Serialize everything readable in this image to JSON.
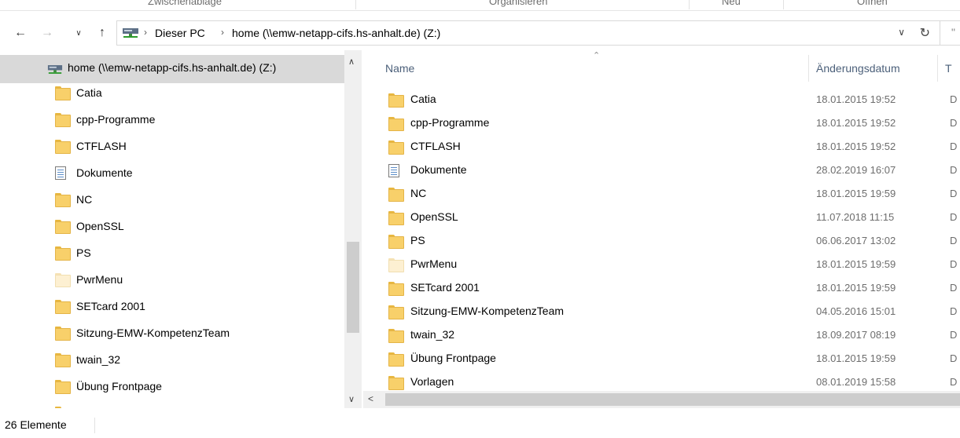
{
  "ribbon": {
    "groups": [
      "Zwischenablage",
      "Organisieren",
      "Neu",
      "Öffnen"
    ]
  },
  "address": {
    "root_label": "Dieser PC",
    "current_label": "home (\\\\emw-netapp-cifs.hs-anhalt.de) (Z:)",
    "search_text": "\""
  },
  "nav": {
    "header_label": "home (\\\\emw-netapp-cifs.hs-anhalt.de) (Z:)",
    "items": [
      {
        "label": "Catia",
        "icon": "folder-icon"
      },
      {
        "label": "cpp-Programme",
        "icon": "folder-icon"
      },
      {
        "label": "CTFLASH",
        "icon": "folder-icon"
      },
      {
        "label": "Dokumente",
        "icon": "document-icon"
      },
      {
        "label": "NC",
        "icon": "folder-icon"
      },
      {
        "label": "OpenSSL",
        "icon": "folder-icon"
      },
      {
        "label": "PS",
        "icon": "folder-icon"
      },
      {
        "label": "PwrMenu",
        "icon": "folder-pale-icon"
      },
      {
        "label": "SETcard 2001",
        "icon": "folder-icon"
      },
      {
        "label": "Sitzung-EMW-KompetenzTeam",
        "icon": "folder-icon"
      },
      {
        "label": "twain_32",
        "icon": "folder-icon"
      },
      {
        "label": "Übung Frontpage",
        "icon": "folder-icon"
      }
    ]
  },
  "columns": {
    "name": "Name",
    "date": "Änderungsdatum",
    "type": "T"
  },
  "files": [
    {
      "name": "Catia",
      "date": "18.01.2015 19:52",
      "type": "D",
      "icon": "folder-icon"
    },
    {
      "name": "cpp-Programme",
      "date": "18.01.2015 19:52",
      "type": "D",
      "icon": "folder-icon"
    },
    {
      "name": "CTFLASH",
      "date": "18.01.2015 19:52",
      "type": "D",
      "icon": "folder-icon"
    },
    {
      "name": "Dokumente",
      "date": "28.02.2019 16:07",
      "type": "D",
      "icon": "document-icon"
    },
    {
      "name": "NC",
      "date": "18.01.2015 19:59",
      "type": "D",
      "icon": "folder-icon"
    },
    {
      "name": "OpenSSL",
      "date": "11.07.2018 11:15",
      "type": "D",
      "icon": "folder-icon"
    },
    {
      "name": "PS",
      "date": "06.06.2017 13:02",
      "type": "D",
      "icon": "folder-icon"
    },
    {
      "name": "PwrMenu",
      "date": "18.01.2015 19:59",
      "type": "D",
      "icon": "folder-pale-icon"
    },
    {
      "name": "SETcard 2001",
      "date": "18.01.2015 19:59",
      "type": "D",
      "icon": "folder-icon"
    },
    {
      "name": "Sitzung-EMW-KompetenzTeam",
      "date": "04.05.2016 15:01",
      "type": "D",
      "icon": "folder-icon"
    },
    {
      "name": "twain_32",
      "date": "18.09.2017 08:19",
      "type": "D",
      "icon": "folder-icon"
    },
    {
      "name": "Übung Frontpage",
      "date": "18.01.2015 19:59",
      "type": "D",
      "icon": "folder-icon"
    },
    {
      "name": "Vorlagen",
      "date": "08.01.2019 15:58",
      "type": "D",
      "icon": "folder-icon"
    }
  ],
  "status": {
    "count_text": "26 Elemente"
  },
  "colors": {
    "selected_bg": "#d9d9d9",
    "header_text": "#4c607a",
    "folder": "#f8d06a"
  }
}
